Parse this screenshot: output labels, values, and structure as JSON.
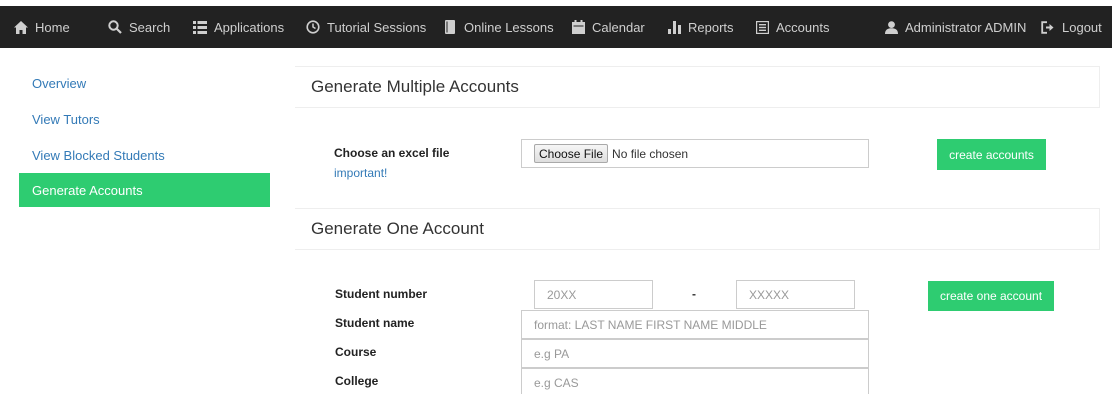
{
  "navbar": {
    "items": [
      {
        "label": "Home",
        "icon": "home-icon"
      },
      {
        "label": "Search",
        "icon": "search-icon"
      },
      {
        "label": "Applications",
        "icon": "list-icon"
      },
      {
        "label": "Tutorial Sessions",
        "icon": "clock-icon"
      },
      {
        "label": "Online Lessons",
        "icon": "book-icon"
      },
      {
        "label": "Calendar",
        "icon": "calendar-icon"
      },
      {
        "label": "Reports",
        "icon": "bar-chart-icon"
      },
      {
        "label": "Accounts",
        "icon": "list-alt-icon"
      }
    ],
    "user_label": "Administrator ADMIN",
    "logout_label": "Logout"
  },
  "sidebar": {
    "items": [
      {
        "label": "Overview",
        "active": false
      },
      {
        "label": "View Tutors",
        "active": false
      },
      {
        "label": "View Blocked Students",
        "active": false
      },
      {
        "label": "Generate Accounts",
        "active": true
      }
    ]
  },
  "multiple": {
    "title": "Generate Multiple Accounts",
    "file_label": "Choose an excel file",
    "important_link": "important!",
    "choose_file_button": "Choose File",
    "no_file_text": "No file chosen",
    "submit_label": "create accounts"
  },
  "single": {
    "title": "Generate One Account",
    "student_number_label": "Student number",
    "year_placeholder": "20XX",
    "dash": "-",
    "serial_placeholder": "XXXXX",
    "submit_label": "create one account",
    "student_name_label": "Student name",
    "student_name_placeholder": "format: LAST NAME FIRST NAME MIDDLE",
    "course_label": "Course",
    "course_placeholder": "e.g PA",
    "college_label": "College",
    "college_placeholder": "e.g CAS"
  },
  "colors": {
    "navbar_bg": "#222222",
    "accent_green": "#2ecc71",
    "link_blue": "#337ab7"
  }
}
